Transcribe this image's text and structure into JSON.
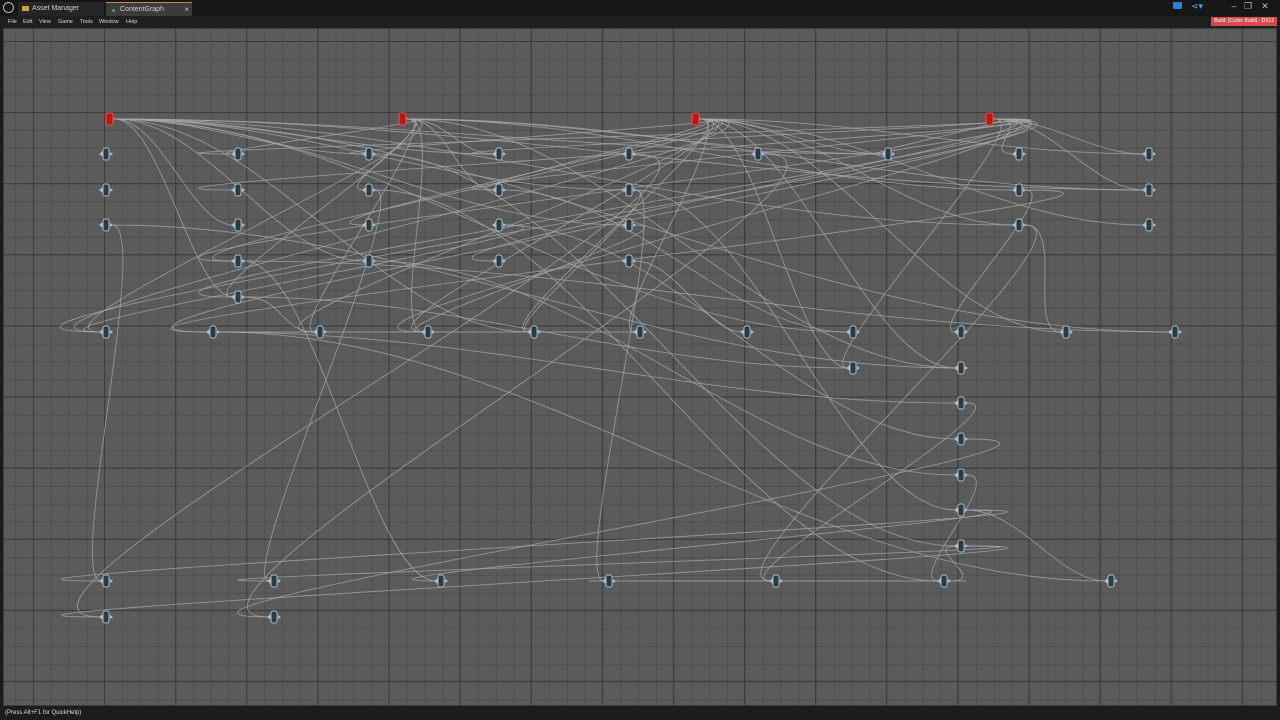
{
  "window": {
    "tabs": [
      {
        "label": "Asset Manager",
        "icon": "folder-icon"
      },
      {
        "label": "ContentGraph",
        "icon": "graph-dot-icon",
        "close": "×"
      }
    ],
    "controls": {
      "minimize": "–",
      "restore": "❐",
      "close": "✕"
    }
  },
  "menu": {
    "items": [
      "File",
      "Edit",
      "View",
      "Game",
      "Tools",
      "Window",
      "Help"
    ],
    "build_badge": "Build: [Coder Build] - DX12"
  },
  "status": {
    "text": "(Press Alt+F1 for QuickHelp)"
  },
  "colors": {
    "canvas": "#5b5b5b",
    "grid_major": "#3b3b3b",
    "wire": "#a9a9a9",
    "node_root": "#b01b1b",
    "node": "#a8c0d0",
    "accent": "#d08a2a"
  }
}
